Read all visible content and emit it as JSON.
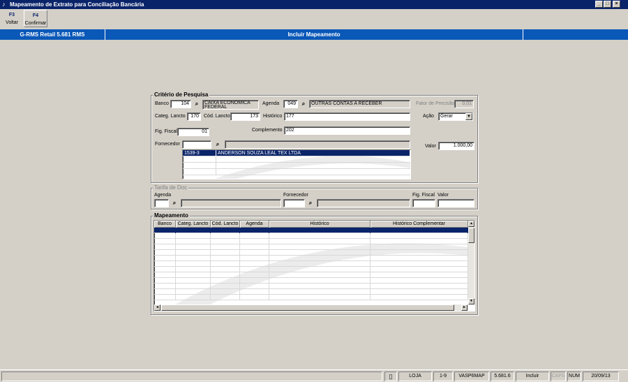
{
  "window": {
    "title": "Mapeamento de Extrato para Conciliação Bancária"
  },
  "toolbar": {
    "buttons": [
      {
        "key": "F3",
        "label": "Voltar"
      },
      {
        "key": "F4",
        "label": "Confirmar"
      }
    ]
  },
  "header": {
    "app": "G-RMS Retail 5.681 RMS",
    "title": "Incluir Mapeamento"
  },
  "criteria": {
    "title": "Critério de Pesquisa",
    "banco": {
      "label": "Banco",
      "value": "104",
      "desc": "CAIXA ECONOMICA FEDERAL"
    },
    "agenda": {
      "label": "Agenda",
      "value": "049",
      "desc": "OUTRAS CONTAS A RECEBER"
    },
    "fator": {
      "label": "Fator de Precisão",
      "value": "0,01"
    },
    "categ": {
      "label": "Categ. Lancto",
      "value": "170"
    },
    "cod": {
      "label": "Cód. Lancto",
      "value": "173"
    },
    "historico": {
      "label": "Histórico",
      "value": "177"
    },
    "acao": {
      "label": "Ação",
      "value": "Gerar"
    },
    "fig": {
      "label": "Fig. Fiscal",
      "value": "01"
    },
    "complemento": {
      "label": "Complemento",
      "value": "202"
    },
    "fornecedor": {
      "label": "Fornecedor",
      "value": "",
      "desc": ""
    },
    "valor": {
      "label": "Valor",
      "value": "1.000,00"
    },
    "list": [
      {
        "code": "1539-3",
        "name": "ANDERSON SOUZA LEAL TEX LTDA"
      }
    ]
  },
  "tarifa": {
    "title": "Tarifa de Doc",
    "agenda": {
      "label": "Agenda",
      "value": ""
    },
    "fornecedor": {
      "label": "Fornecedor",
      "value": ""
    },
    "fig": {
      "label": "Fig. Fiscal",
      "value": ""
    },
    "valor": {
      "label": "Valor",
      "value": ""
    }
  },
  "mapeamento": {
    "title": "Mapeamento",
    "columns": [
      "Banco",
      "Categ. Lancto",
      "Cód. Lancto",
      "Agenda",
      "Histórico",
      "Histórico Complementar"
    ]
  },
  "statusbar": {
    "panels": [
      "LOJA",
      "1-9",
      "VASP6MAP",
      "5.681.6",
      "Incluir",
      "CAPS",
      "NUM",
      "20/09/13"
    ]
  }
}
